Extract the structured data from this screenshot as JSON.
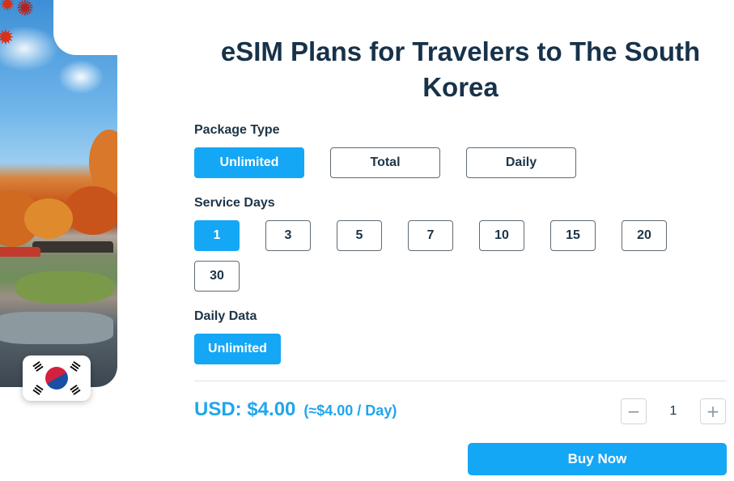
{
  "title": "eSIM Plans for Travelers to The South Korea",
  "flag_icon": "south-korea-flag-icon",
  "package_type": {
    "label": "Package Type",
    "options": [
      "Unlimited",
      "Total",
      "Daily"
    ],
    "selected": "Unlimited"
  },
  "service_days": {
    "label": "Service Days",
    "options": [
      "1",
      "3",
      "5",
      "7",
      "10",
      "15",
      "20",
      "30"
    ],
    "selected": "1"
  },
  "daily_data": {
    "label": "Daily Data",
    "options": [
      "Unlimited"
    ],
    "selected": "Unlimited"
  },
  "price": {
    "amount": "USD: $4.00",
    "per_day": "(≈$4.00 / Day)"
  },
  "quantity": {
    "value": "1",
    "minus": "−",
    "plus": "+"
  },
  "buy_label": "Buy Now",
  "colors": {
    "accent": "#14a7f6",
    "title": "#17324a",
    "price": "#1fa6ee"
  }
}
